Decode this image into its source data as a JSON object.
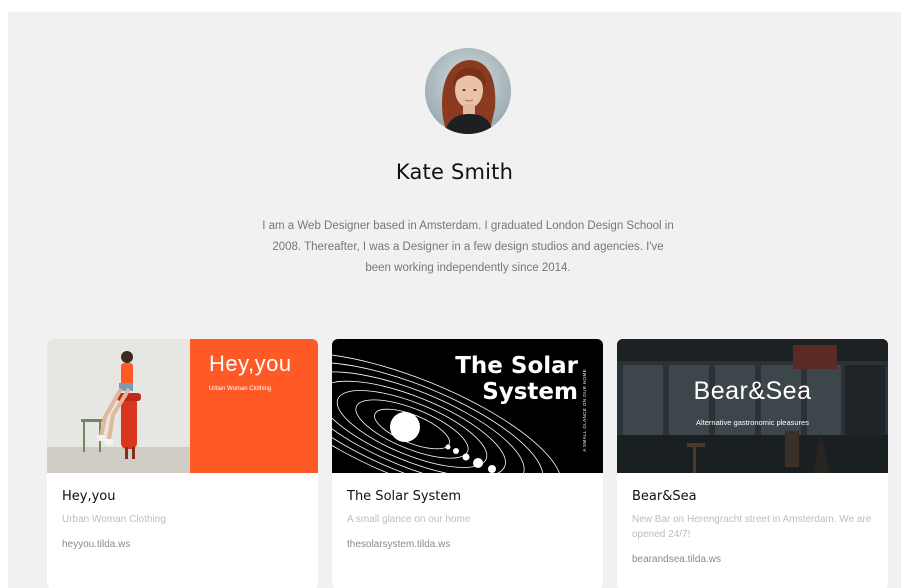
{
  "profile": {
    "name": "Kate Smith",
    "bio": "I am a Web Designer based in Amsterdam. I graduated London Design School in 2008. Thereafter, I was a Designer in a few design studios and agencies. I've been working independently since 2014."
  },
  "projects": [
    {
      "title": "Hey,you",
      "description": "Urban Woman Clothing",
      "link": "heyyou.tilda.ws",
      "thumb_title": "Hey,you",
      "thumb_subtitle": "Urban Woman Clothing",
      "accent": "#ff5a26"
    },
    {
      "title": "The Solar System",
      "description": "A small glance on our home",
      "link": "thesolarsystem.tilda.ws",
      "thumb_title_1": "The Solar",
      "thumb_title_2": "System",
      "thumb_side": "A SMALL GLANCE ON OUR HOME"
    },
    {
      "title": "Bear&Sea",
      "description": "New Bar on Herengracht street in Amsterdam. We are opened 24/7!",
      "link": "bearandsea.tilda.ws",
      "thumb_title": "Bear&Sea",
      "thumb_subtitle": "Alternative gastronomic pleasures"
    }
  ]
}
